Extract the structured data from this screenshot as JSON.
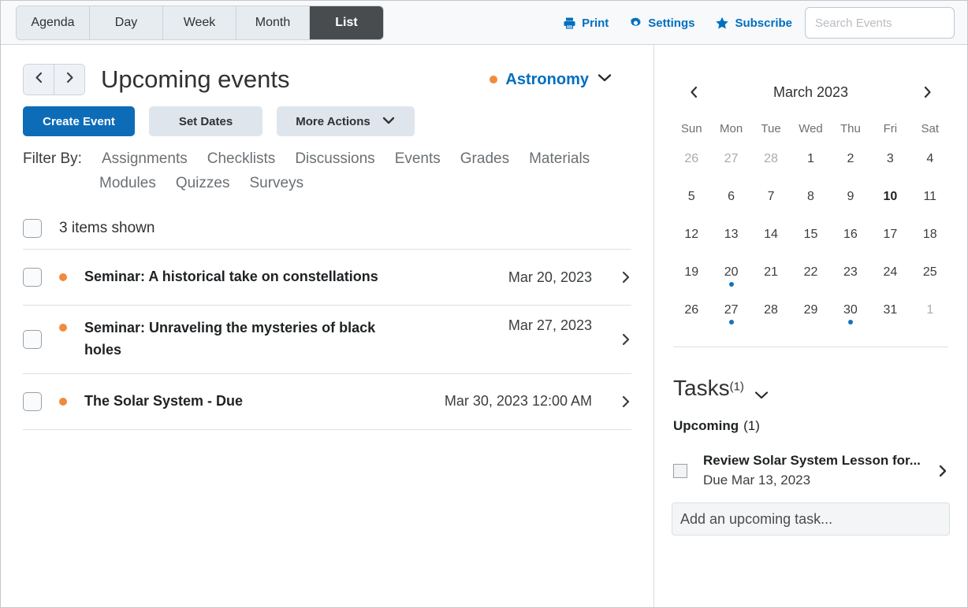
{
  "toolbar": {
    "view_tabs": [
      {
        "label": "Agenda",
        "active": false
      },
      {
        "label": "Day",
        "active": false
      },
      {
        "label": "Week",
        "active": false
      },
      {
        "label": "Month",
        "active": false
      },
      {
        "label": "List",
        "active": true
      }
    ],
    "actions": [
      {
        "label": "Print",
        "icon": "printer-icon"
      },
      {
        "label": "Settings",
        "icon": "gear-icon"
      },
      {
        "label": "Subscribe",
        "icon": "star-icon"
      }
    ],
    "search": {
      "value": "",
      "placeholder": "Search Events"
    }
  },
  "main": {
    "page_title": "Upcoming events",
    "prev_label": "‹",
    "next_label": "›",
    "calendar_selector": {
      "name": "Astronomy",
      "color": "#ef8b3e"
    },
    "buttons": {
      "create_event": "Create Event",
      "set_dates": "Set Dates",
      "more_actions": "More Actions"
    },
    "filter": {
      "label": "Filter By:",
      "row1": [
        "Assignments",
        "Checklists",
        "Discussions",
        "Events",
        "Grades",
        "Materials"
      ],
      "row2": [
        "Modules",
        "Quizzes",
        "Surveys"
      ]
    },
    "list_header": "3 items shown",
    "events": [
      {
        "title": "Seminar: A historical take on constellations",
        "date": "Mar 20, 2023",
        "dot": "#ef8b3e"
      },
      {
        "title": "Seminar: Unraveling the mysteries of black holes",
        "date": "Mar 27, 2023",
        "dot": "#ef8b3e"
      },
      {
        "title": "The Solar System - Due",
        "date": "Mar 30, 2023 12:00 AM",
        "dot": "#ef8b3e"
      }
    ]
  },
  "sidebar": {
    "calendar": {
      "title": "March 2023",
      "prev_label": "‹",
      "next_label": "›",
      "dow": [
        "Sun",
        "Mon",
        "Tue",
        "Wed",
        "Thu",
        "Fri",
        "Sat"
      ],
      "weeks": [
        [
          {
            "d": "26",
            "muted": true
          },
          {
            "d": "27",
            "muted": true
          },
          {
            "d": "28",
            "muted": true
          },
          {
            "d": "1"
          },
          {
            "d": "2"
          },
          {
            "d": "3"
          },
          {
            "d": "4"
          }
        ],
        [
          {
            "d": "5"
          },
          {
            "d": "6"
          },
          {
            "d": "7"
          },
          {
            "d": "8"
          },
          {
            "d": "9"
          },
          {
            "d": "10",
            "today": true
          },
          {
            "d": "11"
          }
        ],
        [
          {
            "d": "12"
          },
          {
            "d": "13"
          },
          {
            "d": "14"
          },
          {
            "d": "15"
          },
          {
            "d": "16"
          },
          {
            "d": "17"
          },
          {
            "d": "18"
          }
        ],
        [
          {
            "d": "19"
          },
          {
            "d": "20",
            "event": true
          },
          {
            "d": "21"
          },
          {
            "d": "22"
          },
          {
            "d": "23"
          },
          {
            "d": "24"
          },
          {
            "d": "25"
          }
        ],
        [
          {
            "d": "26"
          },
          {
            "d": "27",
            "event": true
          },
          {
            "d": "28"
          },
          {
            "d": "29"
          },
          {
            "d": "30",
            "event": true
          },
          {
            "d": "31"
          },
          {
            "d": "1",
            "muted": true
          }
        ]
      ],
      "event_dot_color": "#1572ba"
    },
    "tasks": {
      "title": "Tasks",
      "count": "(1)",
      "group_label": "Upcoming",
      "group_count": "(1)",
      "items": [
        {
          "title": "Review Solar System Lesson for...",
          "due": "Due Mar 13, 2023"
        }
      ],
      "add_input": {
        "value": "",
        "placeholder": "Add an upcoming task..."
      }
    }
  }
}
